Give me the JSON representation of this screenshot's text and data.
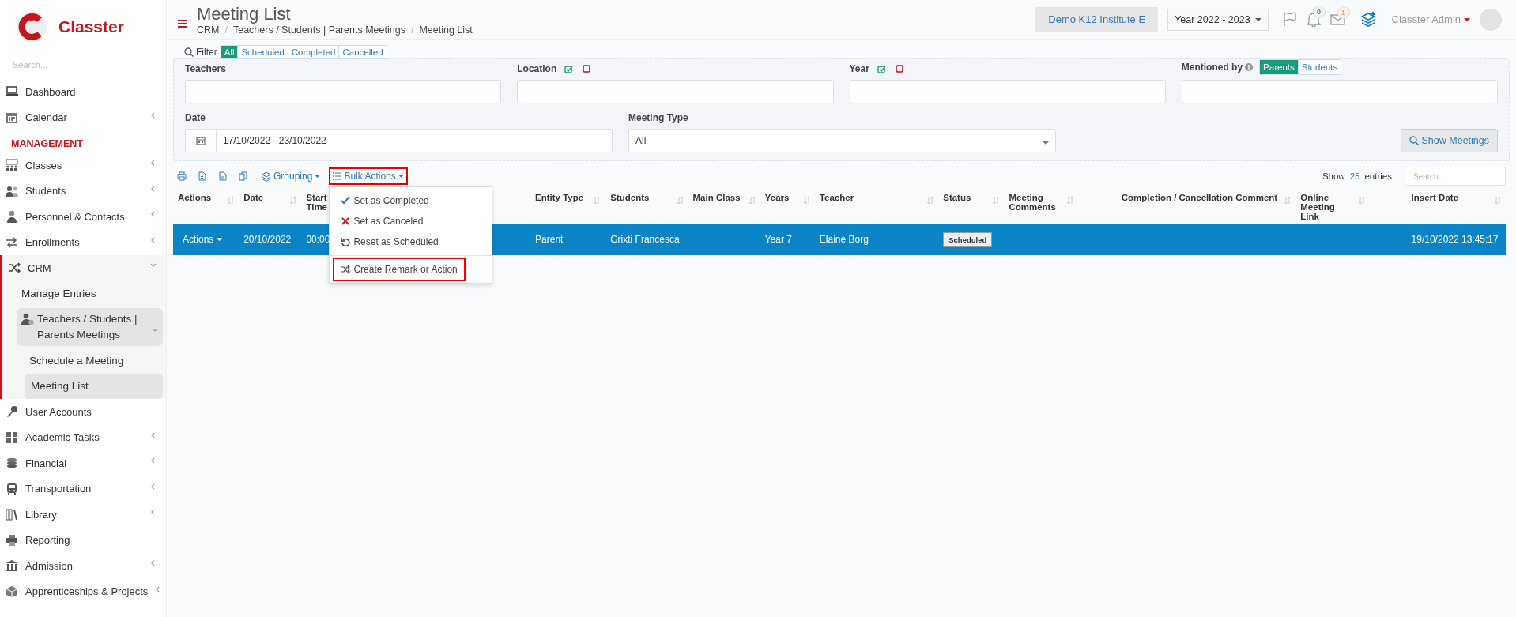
{
  "sidebar": {
    "brand": "Classter",
    "search": {
      "placeholder": "Search..."
    },
    "items": [
      {
        "kind": "link",
        "label": "Dashboard",
        "selected": false
      },
      {
        "kind": "group",
        "label": "Calendar",
        "expanded": false,
        "selected": false
      },
      {
        "kind": "heading",
        "label": "MANAGEMENT"
      },
      {
        "kind": "group",
        "label": "Classes",
        "expanded": false,
        "selected": false
      },
      {
        "kind": "group",
        "label": "Students",
        "expanded": false,
        "selected": false
      },
      {
        "kind": "group",
        "label": "Personnel & Contacts",
        "expanded": false,
        "selected": false
      },
      {
        "kind": "group",
        "label": "Enrollments",
        "expanded": false,
        "selected": false
      },
      {
        "kind": "group",
        "label": "CRM",
        "expanded": true,
        "selected": true,
        "children": [
          {
            "kind": "link",
            "label": "Manage Entries",
            "selected": false
          },
          {
            "kind": "group",
            "label": "Teachers / Students | Parents Meetings",
            "expanded": true,
            "selected": true,
            "children": [
              {
                "label": "Schedule a Meeting",
                "selected": false
              },
              {
                "label": "Meeting List",
                "selected": true
              }
            ]
          }
        ]
      },
      {
        "kind": "link",
        "label": "User Accounts",
        "selected": false
      },
      {
        "kind": "group",
        "label": "Academic Tasks",
        "expanded": false,
        "selected": false
      },
      {
        "kind": "group",
        "label": "Financial",
        "expanded": false,
        "selected": false
      },
      {
        "kind": "group",
        "label": "Transportation",
        "expanded": false,
        "selected": false
      },
      {
        "kind": "group",
        "label": "Library",
        "expanded": false,
        "selected": false
      },
      {
        "kind": "link",
        "label": "Reporting",
        "selected": false
      },
      {
        "kind": "group",
        "label": "Admission",
        "expanded": false,
        "selected": false
      },
      {
        "kind": "group",
        "label": "Apprenticeships & Projects",
        "expanded": false,
        "selected": false
      }
    ]
  },
  "header": {
    "title": "Meeting List",
    "breadcrumb_separator": "/",
    "breadcrumb": [
      "CRM",
      "Teachers / Students | Parents Meetings",
      "Meeting List"
    ],
    "institute": "Demo K12 Institute E",
    "year": "Year 2022 - 2023",
    "notifications": "0",
    "messages": "1",
    "user": "Classter Admin"
  },
  "filter": {
    "label": "Filter",
    "tabs": [
      {
        "label": "All",
        "selected": true
      },
      {
        "label": "Scheduled",
        "selected": false
      },
      {
        "label": "Completed",
        "selected": false
      },
      {
        "label": "Cancelled",
        "selected": false
      }
    ],
    "fields": [
      {
        "kind": "text",
        "label": "Teachers"
      },
      {
        "kind": "toggles",
        "label": "Location"
      },
      {
        "kind": "toggles",
        "label": "Year"
      },
      {
        "kind": "mentioned",
        "label": "Mentioned by",
        "options": [
          {
            "label": "Parents",
            "selected": true
          },
          {
            "label": "Students",
            "selected": false
          }
        ]
      },
      {
        "kind": "date",
        "label": "Date",
        "value": "17/10/2022 - 23/10/2022"
      },
      {
        "kind": "select",
        "label": "Meeting Type",
        "value": "All"
      }
    ],
    "button": "Show Meetings"
  },
  "toolbar": {
    "grouping": "Grouping",
    "bulk_actions": {
      "label": "Bulk Actions",
      "highlighted": true,
      "items": [
        {
          "label": "Set as Completed",
          "highlighted": false
        },
        {
          "label": "Set as Canceled",
          "highlighted": false
        },
        {
          "label": "Reset as Scheduled",
          "highlighted": false
        },
        {
          "label": "Create Remark or Action",
          "highlighted": true
        }
      ]
    },
    "show": "Show",
    "page_size": "25",
    "entries": "entries",
    "search": {
      "placeholder": "Search..."
    }
  },
  "table": {
    "columns": [
      "Actions",
      "Date",
      "Start Time",
      "Entity Type",
      "Students",
      "Main Class",
      "Years",
      "Teacher",
      "Status",
      "Meeting Comments",
      "Completion / Cancellation Comment",
      "Online Meeting Link",
      "Insert Date"
    ],
    "rows": [
      {
        "selected": true,
        "cells": [
          {
            "kind": "menu",
            "text": "Actions"
          },
          {
            "kind": "text",
            "text": "20/10/2022"
          },
          {
            "kind": "text",
            "text": "00:00"
          },
          {
            "kind": "text",
            "text": "Parent"
          },
          {
            "kind": "text",
            "text": "Grixti Francesca"
          },
          {
            "kind": "empty"
          },
          {
            "kind": "text",
            "text": "Year 7"
          },
          {
            "kind": "text",
            "text": "Elaine Borg"
          },
          {
            "kind": "badge",
            "text": "Scheduled"
          },
          {
            "kind": "empty"
          },
          {
            "kind": "empty"
          },
          {
            "kind": "empty"
          },
          {
            "kind": "text",
            "text": "19/10/2022 13:45:17"
          }
        ]
      }
    ]
  }
}
